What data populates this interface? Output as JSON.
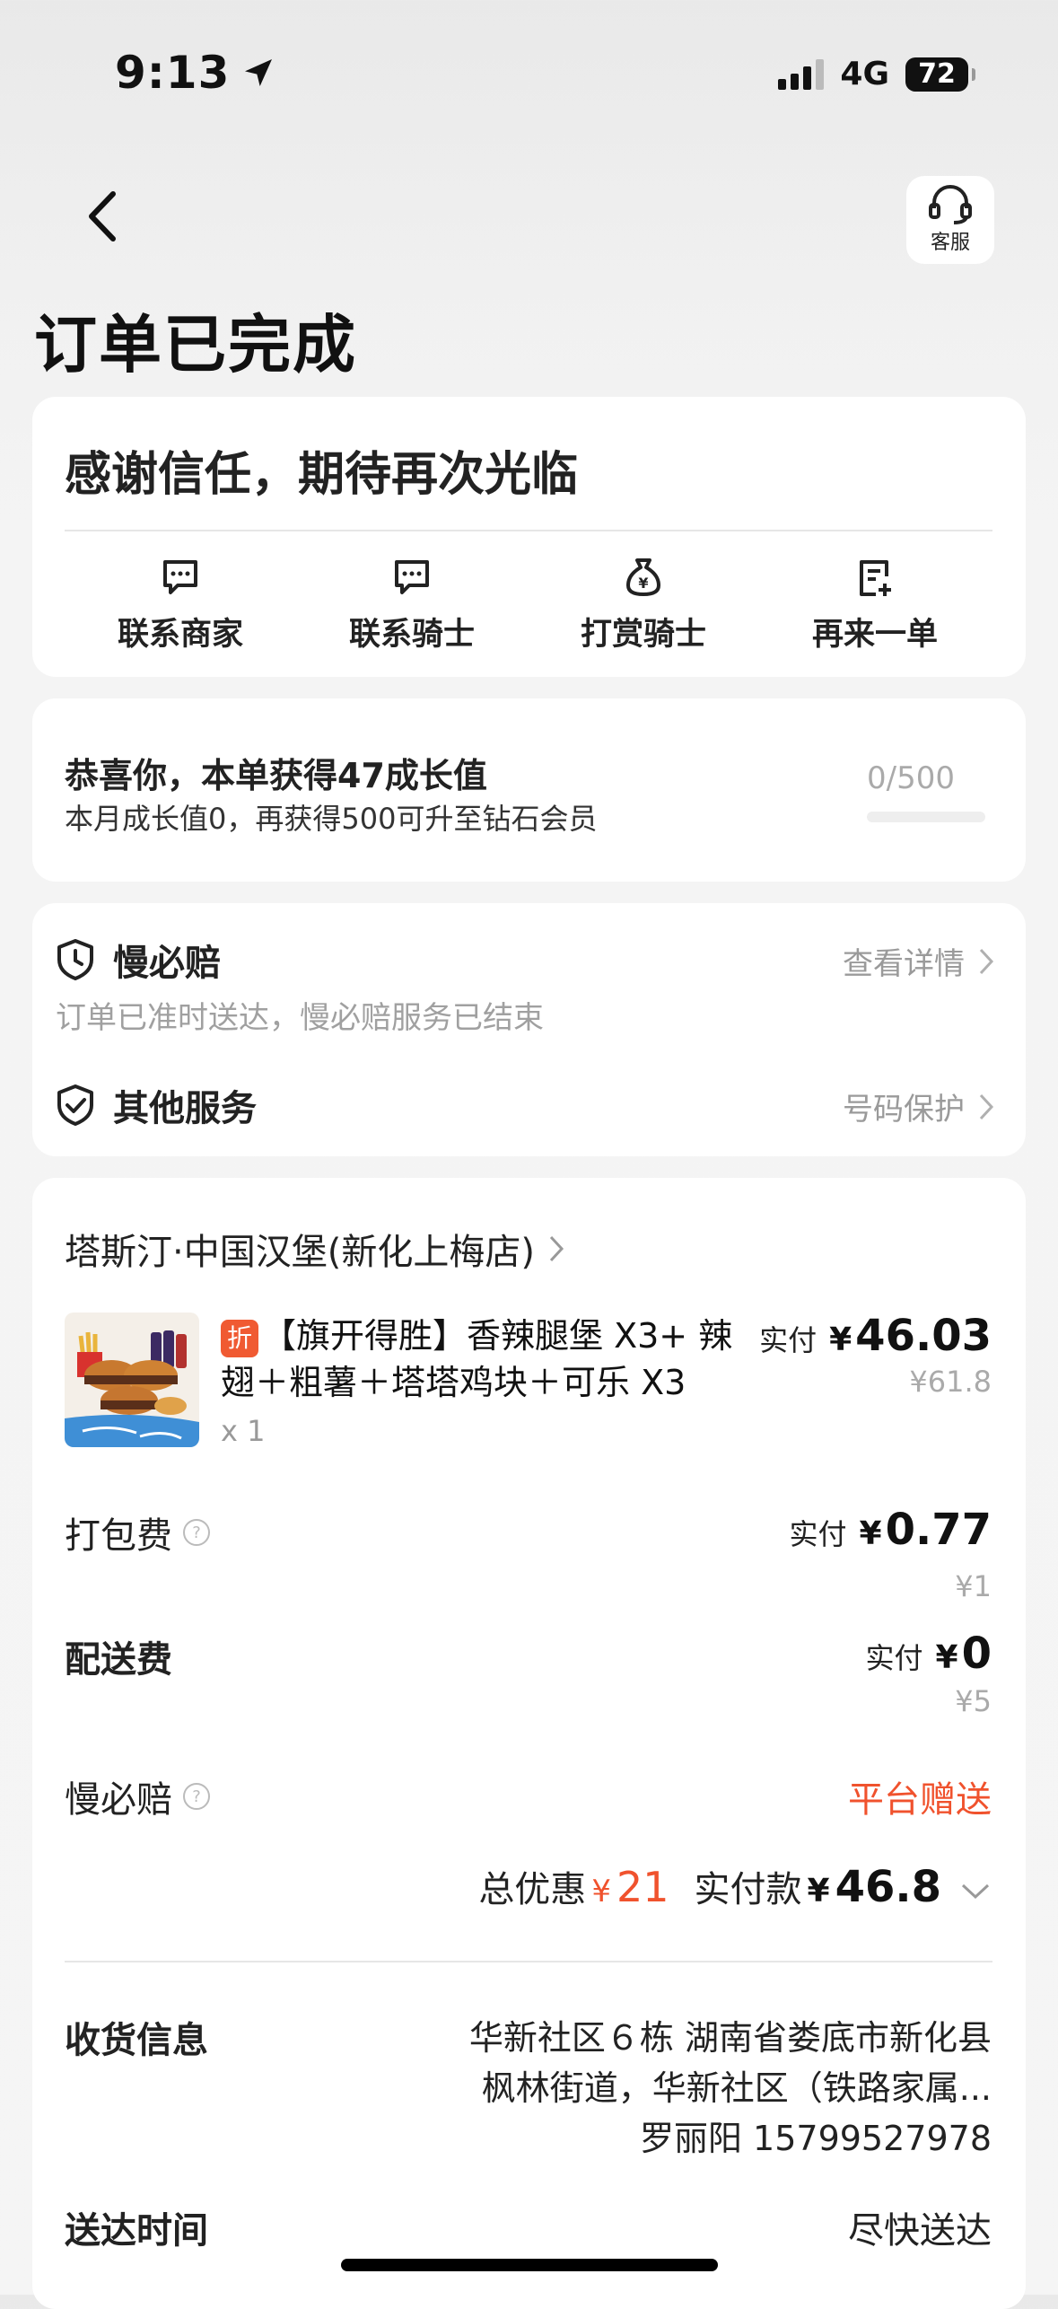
{
  "status_bar": {
    "time": "9:13",
    "network": "4G",
    "battery": "72"
  },
  "header": {
    "customer_service_label": "客服",
    "title": "订单已完成"
  },
  "thanks_card": {
    "message": "感谢信任，期待再次光临",
    "actions": [
      {
        "label": "联系商家",
        "icon": "message-icon"
      },
      {
        "label": "联系骑士",
        "icon": "message-icon"
      },
      {
        "label": "打赏骑士",
        "icon": "money-bag-icon"
      },
      {
        "label": "再来一单",
        "icon": "reorder-icon"
      }
    ]
  },
  "growth_card": {
    "title": "恭喜你，本单获得47成长值",
    "subtitle": "本月成长值0，再获得500可升至钻石会员",
    "count": "0/500",
    "progress": 0
  },
  "service_card": {
    "slow_compensation": {
      "title": "慢必赔",
      "link": "查看详情",
      "note": "订单已准时送达，慢必赔服务已结束"
    },
    "other_services": {
      "title": "其他服务",
      "link": "号码保护"
    }
  },
  "order_card": {
    "store_name": "塔斯汀·中国汉堡(新化上梅店)",
    "product": {
      "discount_tag": "折",
      "name": "【旗开得胜】香辣腿堡 X3+ 辣翅＋粗薯＋塔塔鸡块＋可乐 X3",
      "quantity": "x 1",
      "pay_label": "实付",
      "currency": "¥",
      "price": "46.03",
      "original_price": "¥61.8"
    },
    "packing_fee": {
      "label": "打包费",
      "pay_label": "实付",
      "currency": "¥",
      "price": "0.77",
      "original": "¥1"
    },
    "delivery_fee": {
      "label": "配送费",
      "pay_label": "实付",
      "currency": "¥",
      "price": "0",
      "original": "¥5"
    },
    "slow_comp_row": {
      "label": "慢必赔",
      "value": "平台赠送"
    },
    "summary": {
      "discount_label": "总优惠",
      "discount_currency": "¥",
      "discount_value": "21",
      "total_label": "实付款",
      "total_currency": "¥",
      "total_value": "46.8"
    },
    "receiver": {
      "label": "收货信息",
      "line1": "华新社区６栋 湖南省娄底市新化县",
      "line2": "枫林街道，华新社区（铁路家属...",
      "line3": "罗丽阳 15799527978"
    },
    "delivery_time": {
      "label": "送达时间",
      "value": "尽快送达"
    }
  },
  "colors": {
    "accent_red": "#f0522d",
    "progress_fill": "#f3b443"
  }
}
